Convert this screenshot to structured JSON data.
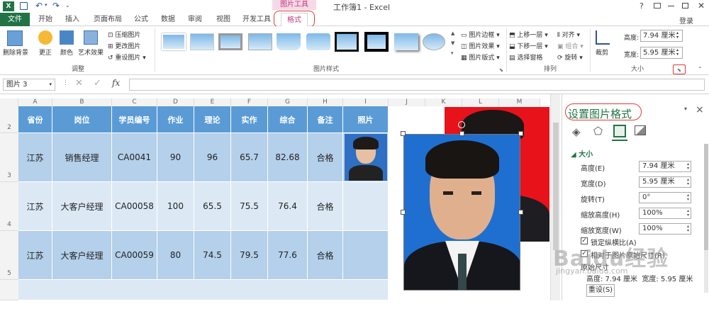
{
  "window": {
    "title": "工作簿1 - Excel",
    "context_tab": "图片工具",
    "login": "登录",
    "help": "?"
  },
  "tabs": [
    "文件",
    "开始",
    "插入",
    "页面布局",
    "公式",
    "数据",
    "审阅",
    "视图",
    "开发工具",
    "格式"
  ],
  "ribbon": {
    "remove_bg": "删除背景",
    "correct": "更正",
    "color": "颜色",
    "artistic": "艺术效果",
    "compress": "压缩图片",
    "change": "更改图片",
    "reset": "重设图片",
    "group_adjust": "调整",
    "group_styles": "图片样式",
    "border": "图片边框",
    "effects": "图片效果",
    "layout": "图片版式",
    "bring_forward": "上移一层",
    "send_backward": "下移一层",
    "selection_pane": "选择窗格",
    "align": "对齐",
    "group": "组合",
    "rotate": "旋转",
    "group_arrange": "排列",
    "crop": "裁剪",
    "height_label": "高度:",
    "height_value": "7.94 厘米",
    "width_label": "宽度:",
    "width_value": "5.95 厘米",
    "group_size": "大小"
  },
  "formula_bar": {
    "name_box": "图片 3",
    "fx": "fx",
    "formula": ""
  },
  "columns": [
    "A",
    "B",
    "C",
    "D",
    "E",
    "F",
    "G",
    "H",
    "I",
    "J",
    "K",
    "L",
    "M"
  ],
  "rows": [
    "2",
    "3",
    "4",
    "5"
  ],
  "table": {
    "headers": [
      "省份",
      "岗位",
      "学员编号",
      "作业",
      "理论",
      "实作",
      "综合",
      "备注",
      "照片"
    ],
    "rows": [
      [
        "江苏",
        "销售经理",
        "CA0041",
        "90",
        "96",
        "65.7",
        "82.68",
        "合格",
        ""
      ],
      [
        "江苏",
        "大客户经理",
        "CA00058",
        "100",
        "65.5",
        "75.5",
        "76.4",
        "合格",
        ""
      ],
      [
        "江苏",
        "大客户经理",
        "CA00059",
        "80",
        "74.5",
        "79.5",
        "77.6",
        "合格",
        ""
      ]
    ]
  },
  "pane": {
    "title": "设置图片格式",
    "close": "×",
    "section": "大小",
    "height_label": "高度(E)",
    "height_value": "7.94 厘米",
    "width_label": "宽度(D)",
    "width_value": "5.95 厘米",
    "rotate_label": "旋转(T)",
    "rotate_value": "0°",
    "scale_h_label": "缩放高度(H)",
    "scale_h_value": "100%",
    "scale_w_label": "缩放宽度(W)",
    "scale_w_value": "100%",
    "lock_ratio": "锁定纵横比(A)",
    "relative_original": "相对于图片原始尺寸(R)",
    "original_size": "原始尺寸",
    "original_values": "高度: 7.94 厘米  宽度: 5.95 厘米",
    "reset_button": "重设(S)"
  },
  "watermark": {
    "logo": "Baidu经验",
    "url": "jingyan.baidu.com"
  },
  "colors": {
    "excel_green": "#217346",
    "header_blue": "#5b9bd5",
    "row_a": "#b4d0ea",
    "row_b": "#dce9f5",
    "context_pink": "#c0397b",
    "photo_blue": "#1f6fd1",
    "photo_red": "#e8121b",
    "annotation_red": "#e23a3a"
  }
}
